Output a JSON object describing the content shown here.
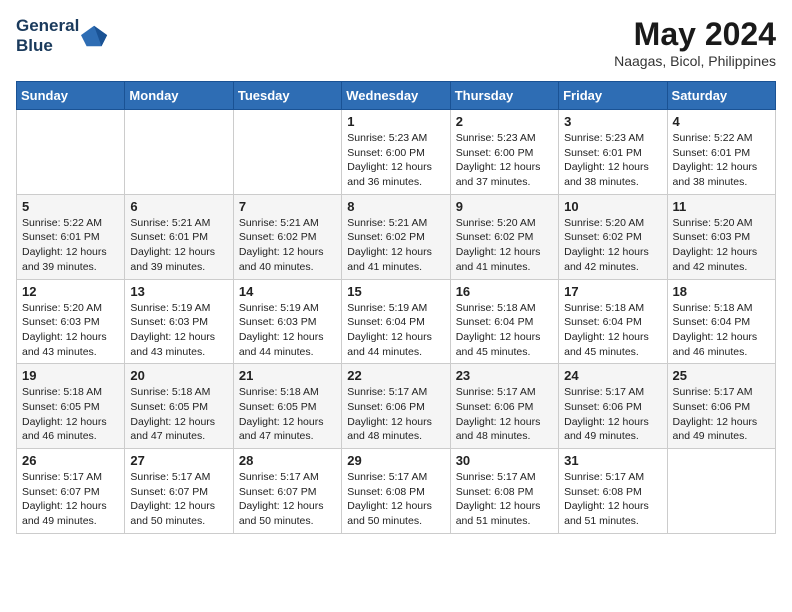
{
  "logo": {
    "line1": "General",
    "line2": "Blue"
  },
  "title": "May 2024",
  "subtitle": "Naagas, Bicol, Philippines",
  "days_of_week": [
    "Sunday",
    "Monday",
    "Tuesday",
    "Wednesday",
    "Thursday",
    "Friday",
    "Saturday"
  ],
  "weeks": [
    [
      {
        "day": "",
        "info": ""
      },
      {
        "day": "",
        "info": ""
      },
      {
        "day": "",
        "info": ""
      },
      {
        "day": "1",
        "info": "Sunrise: 5:23 AM\nSunset: 6:00 PM\nDaylight: 12 hours and 36 minutes."
      },
      {
        "day": "2",
        "info": "Sunrise: 5:23 AM\nSunset: 6:00 PM\nDaylight: 12 hours and 37 minutes."
      },
      {
        "day": "3",
        "info": "Sunrise: 5:23 AM\nSunset: 6:01 PM\nDaylight: 12 hours and 38 minutes."
      },
      {
        "day": "4",
        "info": "Sunrise: 5:22 AM\nSunset: 6:01 PM\nDaylight: 12 hours and 38 minutes."
      }
    ],
    [
      {
        "day": "5",
        "info": "Sunrise: 5:22 AM\nSunset: 6:01 PM\nDaylight: 12 hours and 39 minutes."
      },
      {
        "day": "6",
        "info": "Sunrise: 5:21 AM\nSunset: 6:01 PM\nDaylight: 12 hours and 39 minutes."
      },
      {
        "day": "7",
        "info": "Sunrise: 5:21 AM\nSunset: 6:02 PM\nDaylight: 12 hours and 40 minutes."
      },
      {
        "day": "8",
        "info": "Sunrise: 5:21 AM\nSunset: 6:02 PM\nDaylight: 12 hours and 41 minutes."
      },
      {
        "day": "9",
        "info": "Sunrise: 5:20 AM\nSunset: 6:02 PM\nDaylight: 12 hours and 41 minutes."
      },
      {
        "day": "10",
        "info": "Sunrise: 5:20 AM\nSunset: 6:02 PM\nDaylight: 12 hours and 42 minutes."
      },
      {
        "day": "11",
        "info": "Sunrise: 5:20 AM\nSunset: 6:03 PM\nDaylight: 12 hours and 42 minutes."
      }
    ],
    [
      {
        "day": "12",
        "info": "Sunrise: 5:20 AM\nSunset: 6:03 PM\nDaylight: 12 hours and 43 minutes."
      },
      {
        "day": "13",
        "info": "Sunrise: 5:19 AM\nSunset: 6:03 PM\nDaylight: 12 hours and 43 minutes."
      },
      {
        "day": "14",
        "info": "Sunrise: 5:19 AM\nSunset: 6:03 PM\nDaylight: 12 hours and 44 minutes."
      },
      {
        "day": "15",
        "info": "Sunrise: 5:19 AM\nSunset: 6:04 PM\nDaylight: 12 hours and 44 minutes."
      },
      {
        "day": "16",
        "info": "Sunrise: 5:18 AM\nSunset: 6:04 PM\nDaylight: 12 hours and 45 minutes."
      },
      {
        "day": "17",
        "info": "Sunrise: 5:18 AM\nSunset: 6:04 PM\nDaylight: 12 hours and 45 minutes."
      },
      {
        "day": "18",
        "info": "Sunrise: 5:18 AM\nSunset: 6:04 PM\nDaylight: 12 hours and 46 minutes."
      }
    ],
    [
      {
        "day": "19",
        "info": "Sunrise: 5:18 AM\nSunset: 6:05 PM\nDaylight: 12 hours and 46 minutes."
      },
      {
        "day": "20",
        "info": "Sunrise: 5:18 AM\nSunset: 6:05 PM\nDaylight: 12 hours and 47 minutes."
      },
      {
        "day": "21",
        "info": "Sunrise: 5:18 AM\nSunset: 6:05 PM\nDaylight: 12 hours and 47 minutes."
      },
      {
        "day": "22",
        "info": "Sunrise: 5:17 AM\nSunset: 6:06 PM\nDaylight: 12 hours and 48 minutes."
      },
      {
        "day": "23",
        "info": "Sunrise: 5:17 AM\nSunset: 6:06 PM\nDaylight: 12 hours and 48 minutes."
      },
      {
        "day": "24",
        "info": "Sunrise: 5:17 AM\nSunset: 6:06 PM\nDaylight: 12 hours and 49 minutes."
      },
      {
        "day": "25",
        "info": "Sunrise: 5:17 AM\nSunset: 6:06 PM\nDaylight: 12 hours and 49 minutes."
      }
    ],
    [
      {
        "day": "26",
        "info": "Sunrise: 5:17 AM\nSunset: 6:07 PM\nDaylight: 12 hours and 49 minutes."
      },
      {
        "day": "27",
        "info": "Sunrise: 5:17 AM\nSunset: 6:07 PM\nDaylight: 12 hours and 50 minutes."
      },
      {
        "day": "28",
        "info": "Sunrise: 5:17 AM\nSunset: 6:07 PM\nDaylight: 12 hours and 50 minutes."
      },
      {
        "day": "29",
        "info": "Sunrise: 5:17 AM\nSunset: 6:08 PM\nDaylight: 12 hours and 50 minutes."
      },
      {
        "day": "30",
        "info": "Sunrise: 5:17 AM\nSunset: 6:08 PM\nDaylight: 12 hours and 51 minutes."
      },
      {
        "day": "31",
        "info": "Sunrise: 5:17 AM\nSunset: 6:08 PM\nDaylight: 12 hours and 51 minutes."
      },
      {
        "day": "",
        "info": ""
      }
    ]
  ]
}
